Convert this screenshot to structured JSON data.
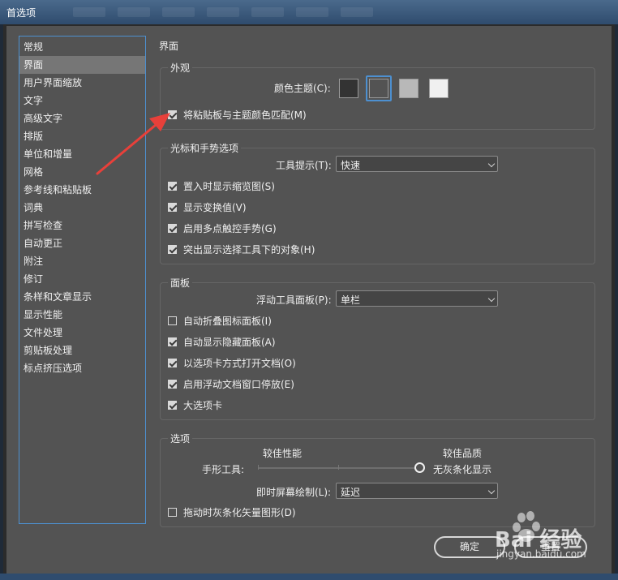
{
  "window": {
    "title": "首选项"
  },
  "sidebar": {
    "items": [
      {
        "label": "常规"
      },
      {
        "label": "界面",
        "selected": true
      },
      {
        "label": "用户界面缩放"
      },
      {
        "label": "文字"
      },
      {
        "label": "高级文字"
      },
      {
        "label": "排版"
      },
      {
        "label": "单位和增量"
      },
      {
        "label": "网格"
      },
      {
        "label": "参考线和粘贴板"
      },
      {
        "label": "词典"
      },
      {
        "label": "拼写检查"
      },
      {
        "label": "自动更正"
      },
      {
        "label": "附注"
      },
      {
        "label": "修订"
      },
      {
        "label": "条样和文章显示"
      },
      {
        "label": "显示性能"
      },
      {
        "label": "文件处理"
      },
      {
        "label": "剪贴板处理"
      },
      {
        "label": "标点挤压选项"
      }
    ]
  },
  "page_title": "界面",
  "appearance": {
    "title": "外观",
    "color_theme_label": "颜色主题(C):",
    "themes": [
      {
        "color": "#333333",
        "selected": false
      },
      {
        "color": "#535353",
        "selected": true
      },
      {
        "color": "#b8b8b8",
        "selected": false
      },
      {
        "color": "#f0f0f0",
        "selected": false
      }
    ],
    "match_pasteboard": {
      "label": "将粘贴板与主题颜色匹配(M)",
      "checked": true
    }
  },
  "cursor": {
    "title": "光标和手势选项",
    "tooltip_label": "工具提示(T):",
    "tooltip_value": "快速",
    "options": [
      {
        "label": "置入时显示缩览图(S)",
        "checked": true
      },
      {
        "label": "显示变换值(V)",
        "checked": true
      },
      {
        "label": "启用多点触控手势(G)",
        "checked": true
      },
      {
        "label": "突出显示选择工具下的对象(H)",
        "checked": true
      }
    ]
  },
  "panels": {
    "title": "面板",
    "floating_label": "浮动工具面板(P):",
    "floating_value": "单栏",
    "options": [
      {
        "label": "自动折叠图标面板(I)",
        "checked": false
      },
      {
        "label": "自动显示隐藏面板(A)",
        "checked": true
      },
      {
        "label": "以选项卡方式打开文档(O)",
        "checked": true
      },
      {
        "label": "启用浮动文档窗口停放(E)",
        "checked": true
      },
      {
        "label": "大选项卡",
        "checked": true
      }
    ]
  },
  "options": {
    "title": "选项",
    "better_performance": "较佳性能",
    "better_quality": "较佳品质",
    "hand_tool_label": "手形工具:",
    "no_greeking": "无灰条化显示",
    "live_draw_label": "即时屏幕绘制(L):",
    "live_draw_value": "延迟",
    "greek_vector": {
      "label": "拖动时灰条化矢量图形(D)",
      "checked": false
    }
  },
  "buttons": {
    "ok": "确定",
    "reset": "重置"
  },
  "watermark": {
    "brand": "Bai 经验",
    "url": "jingyan.baidu.com"
  },
  "colors": {
    "accent": "#4d90d0",
    "panel": "#535353",
    "arrow": "#e8403a"
  }
}
